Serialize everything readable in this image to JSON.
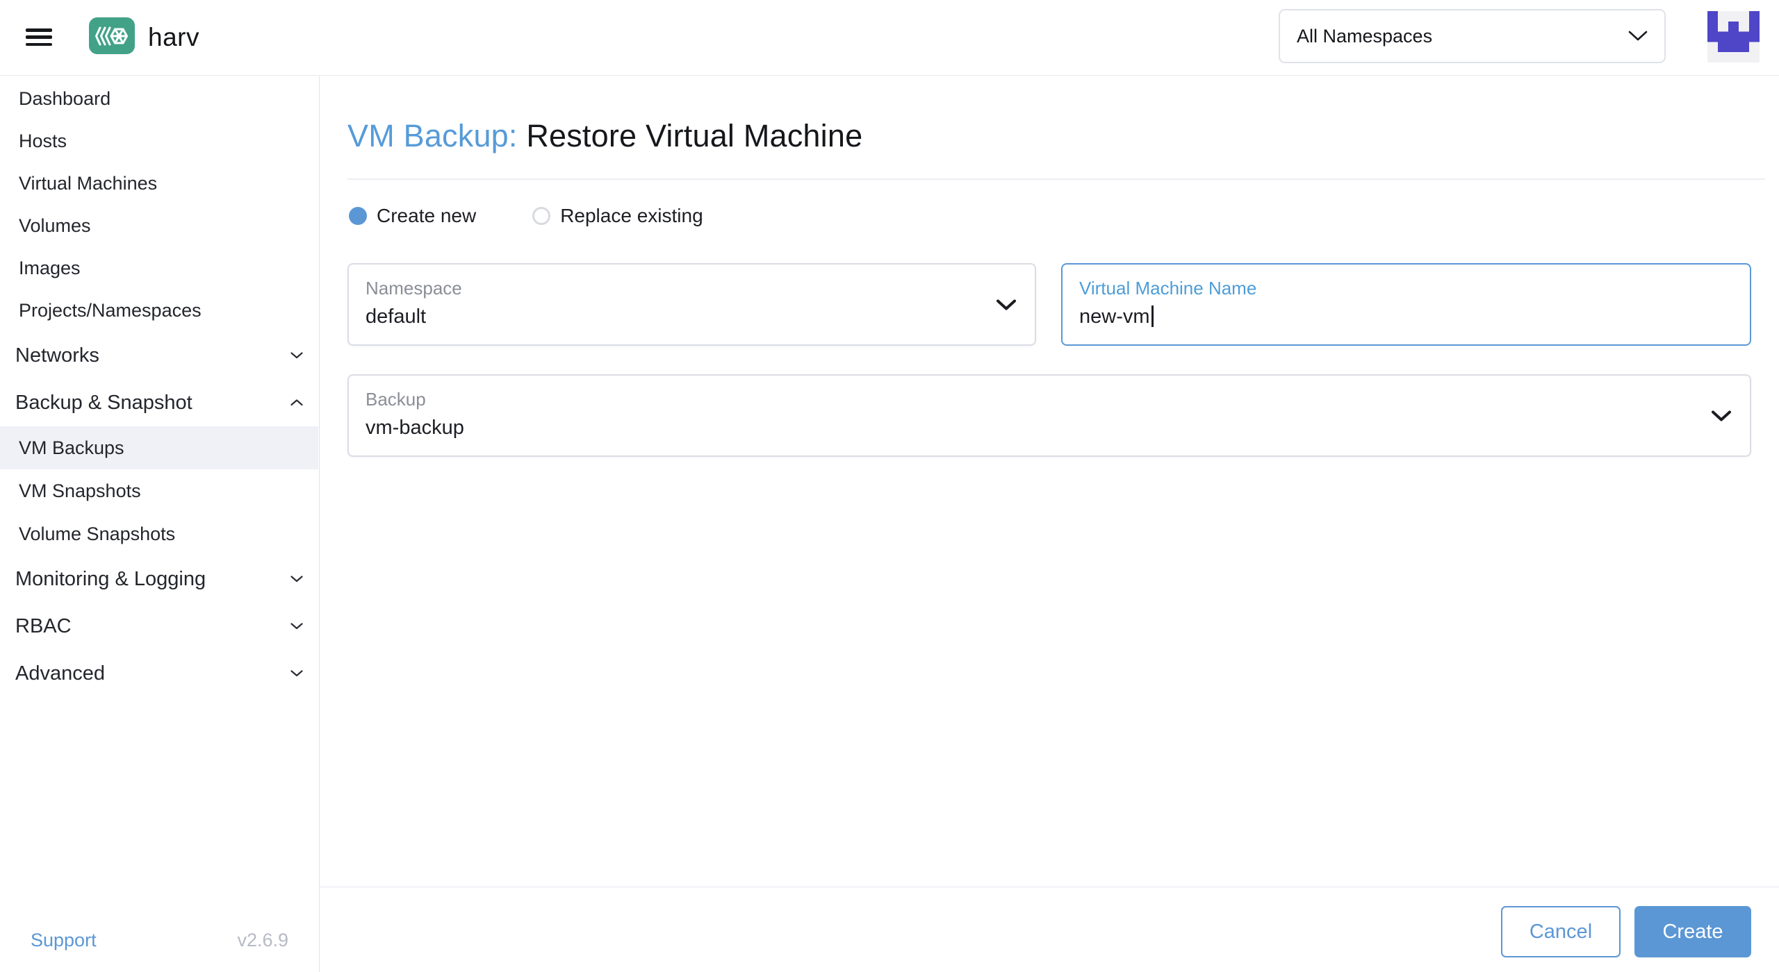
{
  "header": {
    "brand": "harv",
    "namespace_filter": {
      "value": "All Namespaces"
    }
  },
  "sidebar": {
    "items": [
      {
        "label": "Dashboard",
        "type": "item"
      },
      {
        "label": "Hosts",
        "type": "item"
      },
      {
        "label": "Virtual Machines",
        "type": "item"
      },
      {
        "label": "Volumes",
        "type": "item"
      },
      {
        "label": "Images",
        "type": "item"
      },
      {
        "label": "Projects/Namespaces",
        "type": "item"
      },
      {
        "label": "Networks",
        "type": "group",
        "state": "collapsed"
      },
      {
        "label": "Backup & Snapshot",
        "type": "group",
        "state": "expanded"
      },
      {
        "label": "VM Backups",
        "type": "subitem",
        "selected": true
      },
      {
        "label": "VM Snapshots",
        "type": "subitem",
        "selected": false
      },
      {
        "label": "Volume Snapshots",
        "type": "subitem",
        "selected": false
      },
      {
        "label": "Monitoring & Logging",
        "type": "group",
        "state": "collapsed"
      },
      {
        "label": "RBAC",
        "type": "group",
        "state": "collapsed"
      },
      {
        "label": "Advanced",
        "type": "group",
        "state": "collapsed"
      }
    ],
    "footer": {
      "support": "Support",
      "version": "v2.6.9"
    }
  },
  "main": {
    "title_prefix": "VM Backup:",
    "title": "Restore Virtual Machine",
    "radio_options": [
      {
        "label": "Create new",
        "checked": true
      },
      {
        "label": "Replace existing",
        "checked": false
      }
    ],
    "fields": {
      "namespace": {
        "label": "Namespace",
        "value": "default",
        "kind": "dropdown"
      },
      "vm_name": {
        "label": "Virtual Machine Name",
        "value": "new-vm",
        "kind": "text",
        "focused": true
      },
      "backup": {
        "label": "Backup",
        "value": "vm-backup",
        "kind": "dropdown"
      }
    },
    "footer": {
      "cancel": "Cancel",
      "create": "Create"
    }
  },
  "icons": {
    "hamburger": "menu-icon (3 bars)",
    "logo": "harvester-logo (chevrons + hex wheel)",
    "chevron_down": "v",
    "chevron_up": "^",
    "avatar": "purple pixel identicon"
  },
  "colors": {
    "accent_blue": "#5b97d5",
    "title_blue": "#569bd9",
    "logo_green": "#41a287",
    "avatar_purple": "#4e45c7",
    "selected_row_bg": "#f0f1f6",
    "muted_text": "#8b8e96",
    "version_text": "#b7bac5"
  }
}
